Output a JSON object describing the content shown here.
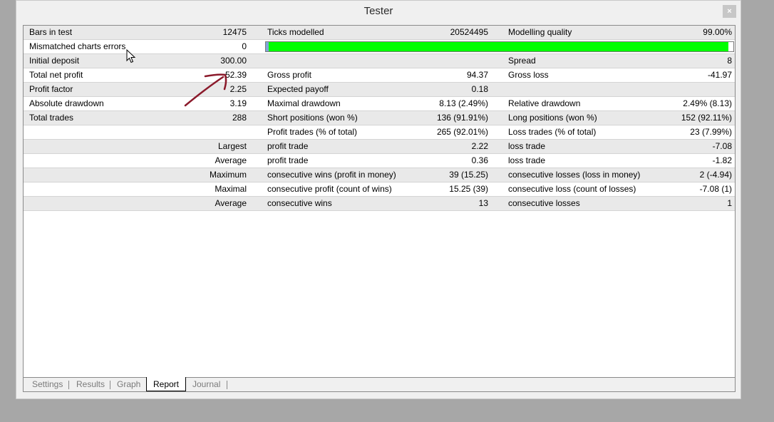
{
  "window": {
    "title": "Tester",
    "close_label": "×"
  },
  "report": {
    "bars_in_test": {
      "label": "Bars in test",
      "value": "12475"
    },
    "ticks_modelled": {
      "label": "Ticks modelled",
      "value": "20524495"
    },
    "modelling_quality": {
      "label": "Modelling quality",
      "value": "99.00%"
    },
    "mismatched_errors": {
      "label": "Mismatched charts errors",
      "value": "0",
      "quality_fraction": 0.99
    },
    "initial_deposit": {
      "label": "Initial deposit",
      "value": "300.00"
    },
    "spread": {
      "label": "Spread",
      "value": "8"
    },
    "total_net_profit": {
      "label": "Total net profit",
      "value": "52.39"
    },
    "gross_profit": {
      "label": "Gross profit",
      "value": "94.37"
    },
    "gross_loss": {
      "label": "Gross loss",
      "value": "-41.97"
    },
    "profit_factor": {
      "label": "Profit factor",
      "value": "2.25"
    },
    "expected_payoff": {
      "label": "Expected payoff",
      "value": "0.18"
    },
    "absolute_drawdown": {
      "label": "Absolute drawdown",
      "value": "3.19"
    },
    "maximal_drawdown": {
      "label": "Maximal drawdown",
      "value": "8.13 (2.49%)"
    },
    "relative_drawdown": {
      "label": "Relative drawdown",
      "value": "2.49% (8.13)"
    },
    "total_trades": {
      "label": "Total trades",
      "value": "288"
    },
    "short_positions": {
      "label": "Short positions (won %)",
      "value": "136 (91.91%)"
    },
    "long_positions": {
      "label": "Long positions (won %)",
      "value": "152 (92.11%)"
    },
    "profit_trades": {
      "label": "Profit trades (% of total)",
      "value": "265 (92.01%)"
    },
    "loss_trades": {
      "label": "Loss trades (% of total)",
      "value": "23 (7.99%)"
    },
    "largest": {
      "label": "Largest",
      "profit_label": "profit trade",
      "profit_value": "2.22",
      "loss_label": "loss trade",
      "loss_value": "-7.08"
    },
    "average": {
      "label": "Average",
      "profit_label": "profit trade",
      "profit_value": "0.36",
      "loss_label": "loss trade",
      "loss_value": "-1.82"
    },
    "maximum": {
      "label": "Maximum",
      "profit_label": "consecutive wins (profit in money)",
      "profit_value": "39 (15.25)",
      "loss_label": "consecutive losses (loss in money)",
      "loss_value": "2 (-4.94)"
    },
    "maximal": {
      "label": "Maximal",
      "profit_label": "consecutive profit (count of wins)",
      "profit_value": "15.25 (39)",
      "loss_label": "consecutive loss (count of losses)",
      "loss_value": "-7.08 (1)"
    },
    "average_consecutive": {
      "label": "Average",
      "profit_label": "consecutive wins",
      "profit_value": "13",
      "loss_label": "consecutive losses",
      "loss_value": "1"
    }
  },
  "tabs": [
    {
      "label": "Settings"
    },
    {
      "label": "Results"
    },
    {
      "label": "Graph"
    },
    {
      "label": "Report",
      "active": true
    },
    {
      "label": "Journal"
    }
  ],
  "colors": {
    "quality_fill": "#00ff00",
    "annotation": "#8b1a2b"
  },
  "icons": {
    "cursor": "mouse-pointer-icon",
    "annotation": "hand-drawn-arrow-icon"
  }
}
